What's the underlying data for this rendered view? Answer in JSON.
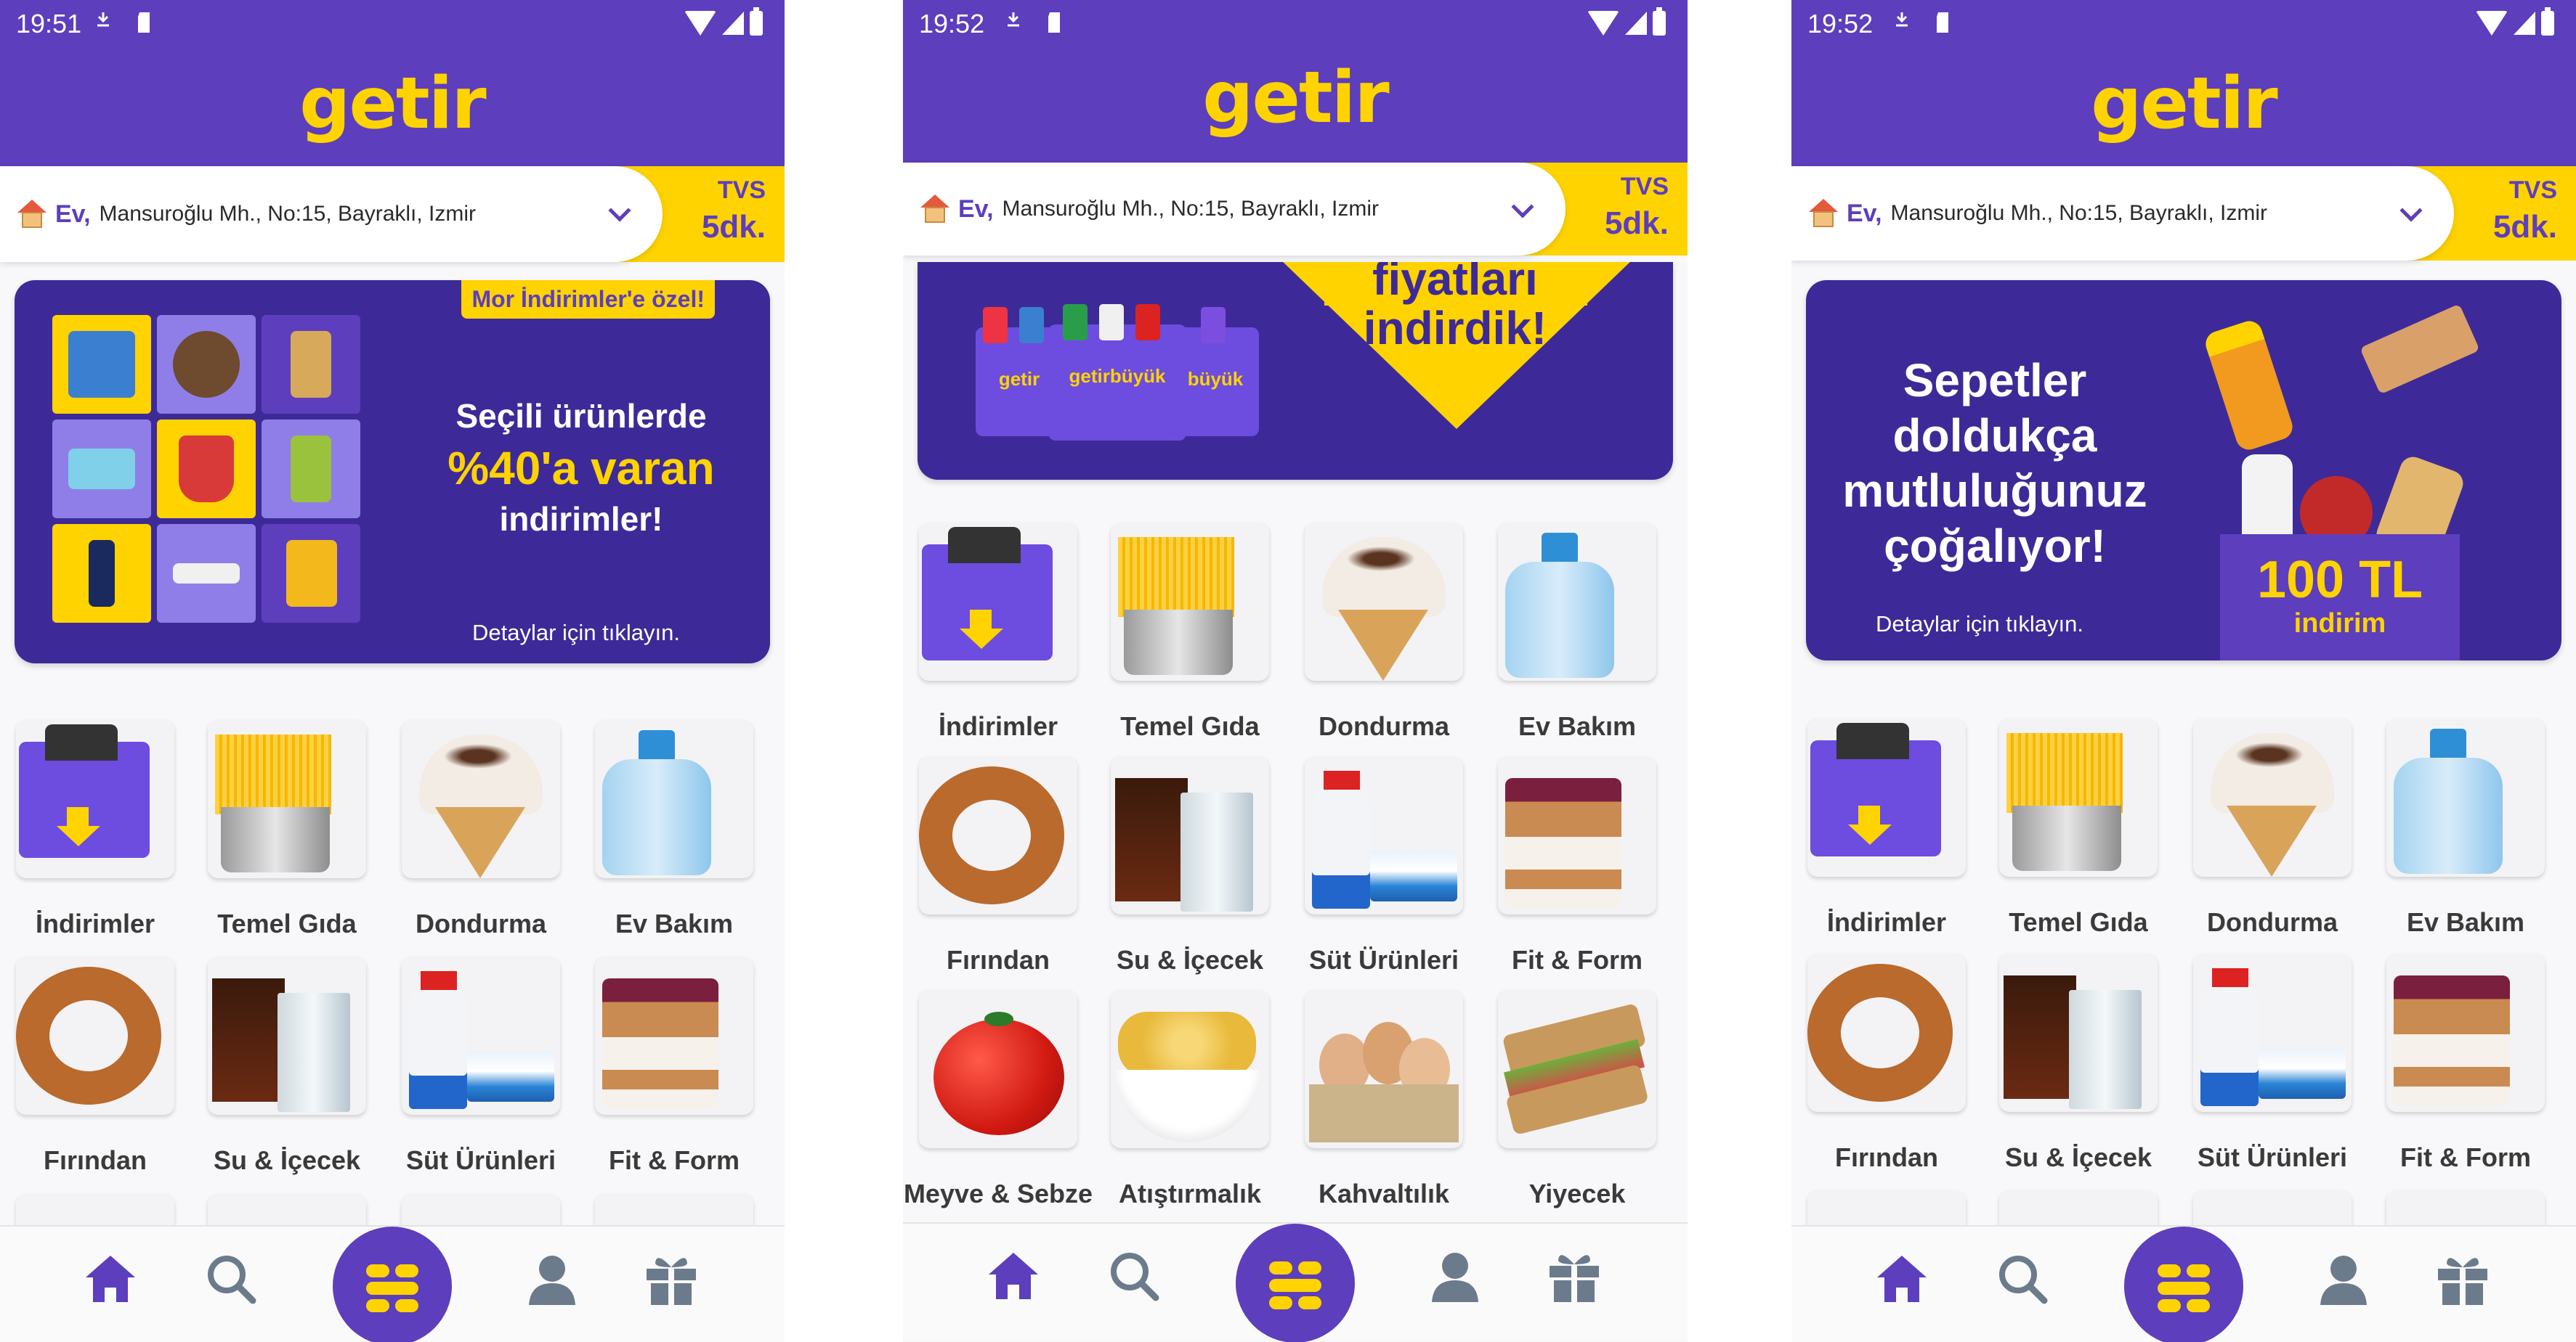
{
  "screens": [
    {
      "status": {
        "time": "19:51"
      },
      "header": {
        "logo": "getir"
      },
      "address": {
        "tag": "Ev,",
        "line": "Mansuroğlu Mh., No:15, Bayraklı, Izmir"
      },
      "eta": {
        "label": "TVS",
        "time": "5dk."
      },
      "banner": {
        "tag": "Mor İndirimler'e özel!",
        "line1": "Seçili ürünlerde",
        "line2": "%40'a varan",
        "line3": "indirimler!",
        "detail": "Detaylar için tıklayın."
      },
      "categories": [
        "İndirimler",
        "Temel Gıda",
        "Dondurma",
        "Ev Bakım",
        "Fırından",
        "Su & İçecek",
        "Süt Ürünleri",
        "Fit & Form"
      ]
    },
    {
      "status": {
        "time": "19:52"
      },
      "header": {
        "logo": "getir"
      },
      "address": {
        "tag": "Ev,",
        "line": "Mansuroğlu Mh., No:15, Bayraklı, Izmir"
      },
      "eta": {
        "label": "TVS",
        "time": "5dk."
      },
      "banner": {
        "line1": "fiyatları",
        "line2": "indirdik!",
        "bag1": "getir",
        "bag2": "getirbüyük",
        "bag3": "büyük"
      },
      "categories": [
        "İndirimler",
        "Temel Gıda",
        "Dondurma",
        "Ev Bakım",
        "Fırından",
        "Su & İçecek",
        "Süt Ürünleri",
        "Fit & Form",
        "Meyve & Sebze",
        "Atıştırmalık",
        "Kahvaltılık",
        "Yiyecek"
      ]
    },
    {
      "status": {
        "time": "19:52"
      },
      "header": {
        "logo": "getir"
      },
      "address": {
        "tag": "Ev,",
        "line": "Mansuroğlu Mh., No:15, Bayraklı, Izmir"
      },
      "eta": {
        "label": "TVS",
        "time": "5dk."
      },
      "banner": {
        "line1": "Sepetler",
        "line2": "doldukça",
        "line3": "mutluluğunuz",
        "line4": "çoğalıyor!",
        "amount": "100 TL",
        "discount": "indirim",
        "detail": "Detaylar için tıklayın."
      },
      "categories": [
        "İndirimler",
        "Temel Gıda",
        "Dondurma",
        "Ev Bakım",
        "Fırından",
        "Su & İçecek",
        "Süt Ürünleri",
        "Fit & Form"
      ]
    }
  ],
  "nav": [
    "home-icon",
    "search-icon",
    "menu-icon",
    "profile-icon",
    "gift-icon"
  ],
  "colors": {
    "brand": "#5d3ebc",
    "accent": "#ffd300",
    "nav_icon": "#6b7b8c"
  }
}
